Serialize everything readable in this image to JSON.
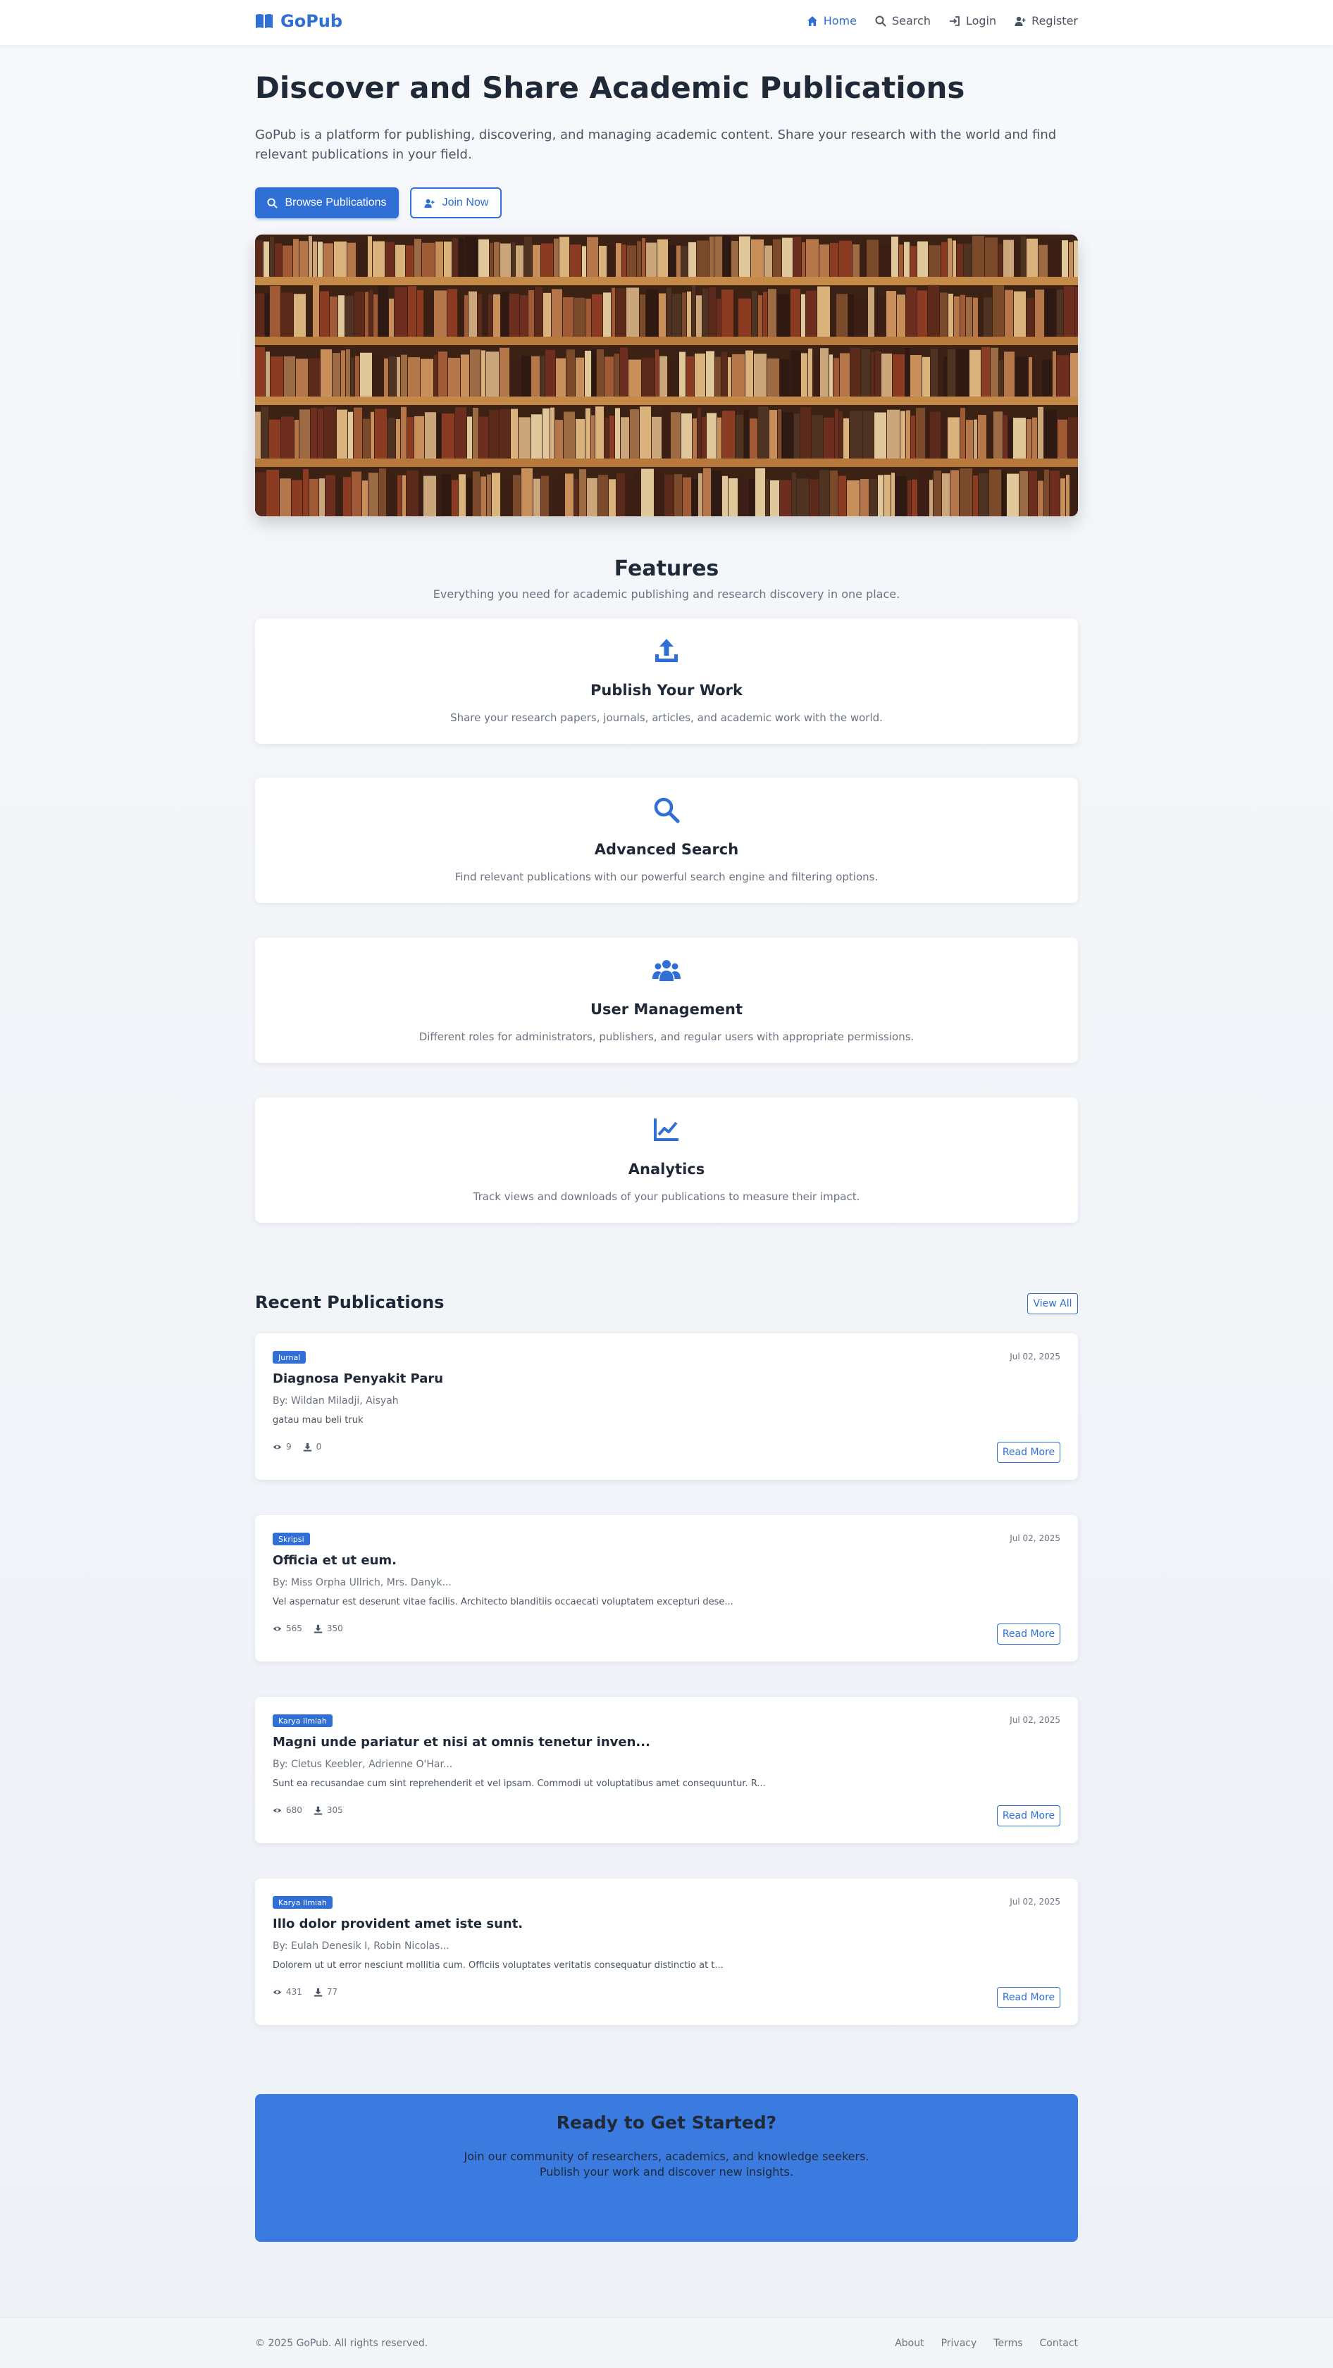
{
  "navbar": {
    "brand": "GoPub",
    "links": [
      {
        "label": "Home",
        "icon": "home-icon",
        "active": true
      },
      {
        "label": "Search",
        "icon": "search-icon"
      },
      {
        "label": "Login",
        "icon": "login-icon"
      },
      {
        "label": "Register",
        "icon": "user-plus-icon"
      }
    ]
  },
  "hero": {
    "title": "Discover and Share Academic Publications",
    "description": "GoPub is a platform for publishing, discovering, and managing academic content. Share your research with the world and find relevant publications in your field.",
    "primary_button": "Browse Publications",
    "secondary_button": "Join Now",
    "image_icon": "bookshelf-image"
  },
  "features": {
    "title": "Features",
    "subtitle": "Everything you need for academic publishing and research discovery in one place.",
    "items": [
      {
        "icon": "upload-icon",
        "title": "Publish Your Work",
        "description": "Share your research papers, journals, articles, and academic work with the world."
      },
      {
        "icon": "search-icon",
        "title": "Advanced Search",
        "description": "Find relevant publications with our powerful search engine and filtering options."
      },
      {
        "icon": "users-icon",
        "title": "User Management",
        "description": "Different roles for administrators, publishers, and regular users with appropriate permissions."
      },
      {
        "icon": "chart-line-icon",
        "title": "Analytics",
        "description": "Track views and downloads of your publications to measure their impact."
      }
    ]
  },
  "recent": {
    "title": "Recent Publications",
    "view_all": "View All",
    "items": [
      {
        "badge": "Jurnal",
        "date": "Jul 02, 2025",
        "title": "Diagnosa Penyakit Paru",
        "authors": "By: Wildan Miladji, Aisyah",
        "abstract": "gatau mau beli truk",
        "views": "9",
        "downloads": "0",
        "read_more": "Read More"
      },
      {
        "badge": "Skripsi",
        "date": "Jul 02, 2025",
        "title": "Officia et ut eum.",
        "authors": "By: Miss Orpha Ullrich, Mrs. Danyk...",
        "abstract": "Vel aspernatur est deserunt vitae facilis. Architecto blanditiis occaecati voluptatem excepturi dese...",
        "views": "565",
        "downloads": "350",
        "read_more": "Read More"
      },
      {
        "badge": "Karya Ilmiah",
        "date": "Jul 02, 2025",
        "title": "Magni unde pariatur et nisi at omnis tenetur inven...",
        "authors": "By: Cletus Keebler, Adrienne O'Har...",
        "abstract": "Sunt ea recusandae cum sint reprehenderit et vel ipsam. Commodi ut voluptatibus amet consequuntur. R...",
        "views": "680",
        "downloads": "305",
        "read_more": "Read More"
      },
      {
        "badge": "Karya Ilmiah",
        "date": "Jul 02, 2025",
        "title": "Illo dolor provident amet iste sunt.",
        "authors": "By: Eulah Denesik I, Robin Nicolas...",
        "abstract": "Dolorem ut ut error nesciunt mollitia cum. Officiis voluptates veritatis consequatur distinctio at t...",
        "views": "431",
        "downloads": "77",
        "read_more": "Read More"
      }
    ]
  },
  "cta": {
    "title": "Ready to Get Started?",
    "description": "Join our community of researchers, academics, and knowledge seekers. Publish your work and discover new insights."
  },
  "footer": {
    "copyright": "© 2025 GoPub. All rights reserved.",
    "links": [
      "About",
      "Privacy",
      "Terms",
      "Contact"
    ]
  },
  "colors": {
    "accent": "#2f6fd6",
    "cta_bg": "#3b7be0"
  }
}
